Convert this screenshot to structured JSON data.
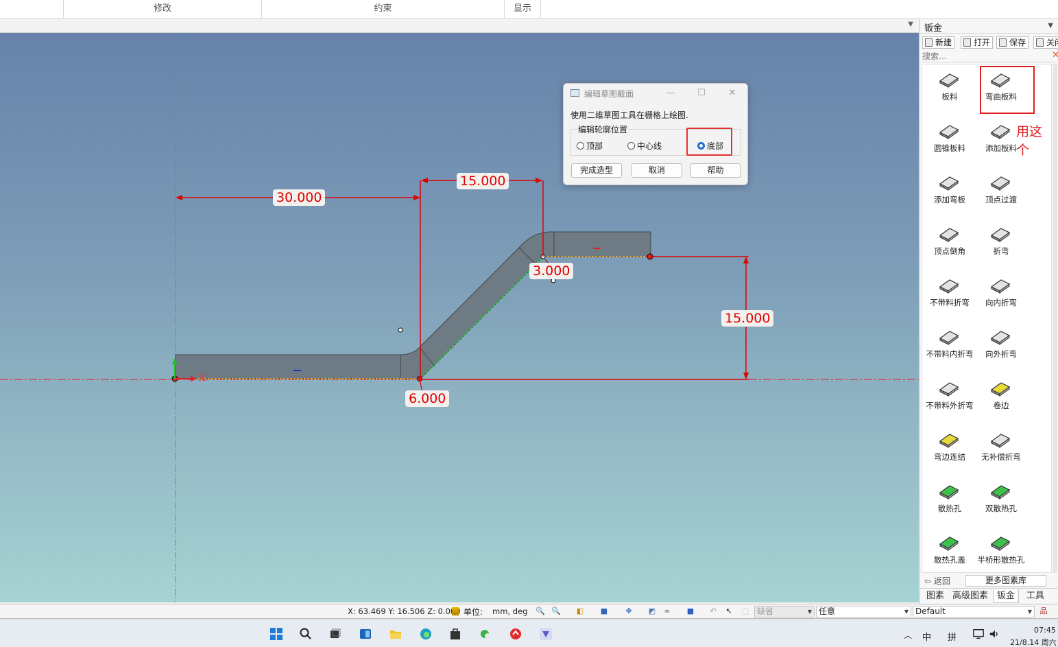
{
  "ribbon": {
    "sections": [
      "修改",
      "约束",
      "显示"
    ]
  },
  "viewport": {
    "dimensions": {
      "d1": "30.000",
      "d2": "15.000",
      "d3": "3.000",
      "d4": "15.000",
      "d5": "6.000"
    },
    "axis_label_x": "X"
  },
  "dialog": {
    "title": "编辑草图截面",
    "message": "使用二维草图工具在栅格上绘图.",
    "group_label": "编辑轮廓位置",
    "options": [
      "顶部",
      "中心线",
      "底部"
    ],
    "selected_option": "底部",
    "buttons": {
      "finish": "完成造型",
      "cancel": "取消",
      "help": "帮助"
    }
  },
  "panel": {
    "title": "钣金",
    "toolbar": {
      "new": "新建",
      "open": "打开",
      "save": "保存",
      "close": "关闭"
    },
    "search_placeholder": "搜索...",
    "tools": [
      "板料",
      "弯曲板料",
      "圆锥板料",
      "添加板料",
      "添加弯板",
      "顶点过渡",
      "顶点倒角",
      "折弯",
      "不带料折弯",
      "向内折弯",
      "不带料内折弯",
      "向外折弯",
      "不带料外折弯",
      "卷边",
      "弯边连结",
      "无补偿折弯",
      "散热孔",
      "双散热孔",
      "散热孔盖",
      "半桥形散热孔"
    ],
    "annotation": "用这个",
    "nav": {
      "back": "返回",
      "more": "更多图素库"
    },
    "tabs": [
      "图素",
      "高级图素",
      "钣金",
      "工具"
    ],
    "active_tab": "钣金"
  },
  "statusbar": {
    "coords": "X: 63.469 Y: 16.506 Z: 0.000",
    "units_label": "单位:",
    "units_value": "mm, deg",
    "filter_default": "缺省",
    "filter_any": "任意",
    "style": "Default"
  },
  "taskbar": {
    "lang": "中",
    "ime": "拼",
    "time": "07:45",
    "date": "21/8.14 周六"
  },
  "colors": {
    "dimension": "#e00000",
    "highlight": "#e02020",
    "part_fill": "#6e7a83",
    "selected_radio": "#1e6fd0"
  }
}
